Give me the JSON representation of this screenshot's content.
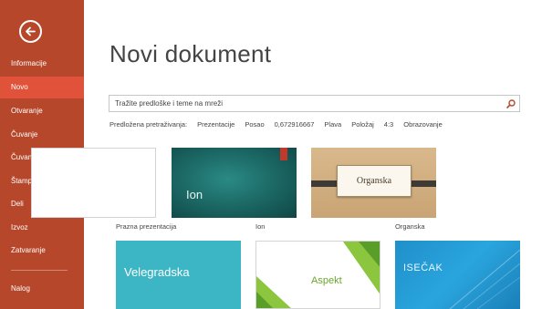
{
  "sidebar": {
    "back_label": "",
    "items": [
      {
        "label": "Informacije",
        "active": false
      },
      {
        "label": "Novo",
        "active": true
      },
      {
        "label": "Otvaranje",
        "active": false
      },
      {
        "label": "Čuvanje",
        "active": false
      },
      {
        "label": "Čuvanje kao",
        "active": false
      },
      {
        "label": "Štampanje",
        "active": false
      },
      {
        "label": "Deli",
        "active": false
      },
      {
        "label": "Izvoz",
        "active": false
      },
      {
        "label": "Zatvaranje",
        "active": false
      }
    ],
    "account": {
      "label": "Nalog"
    }
  },
  "main": {
    "title": "Novi dokument",
    "search": {
      "value": "",
      "placeholder": "Tražite predloške i teme na mreži"
    },
    "suggested": {
      "label": "Predložena pretraživanja:",
      "links": [
        "Prezentacije",
        "Posao",
        "0,672916667",
        "Plava",
        "Položaj",
        "4:3",
        "Obrazovanje"
      ]
    },
    "templates": [
      {
        "caption": "Prazna prezentacija",
        "preview_text": ""
      },
      {
        "caption": "Ion",
        "preview_text": "Ion"
      },
      {
        "caption": "Organska",
        "preview_text": "Organska"
      },
      {
        "caption": "",
        "preview_text": "Velegradska"
      },
      {
        "caption": "",
        "preview_text": "Aspekt"
      },
      {
        "caption": "",
        "preview_text": "ISEČAK"
      }
    ]
  },
  "colors": {
    "sidebar": "#b7472a",
    "sidebar_active": "#e0533a",
    "ion": "#1a6461",
    "velegradska": "#3cb5c5",
    "aspekt_green": "#6aa62b",
    "isecak": "#2aa5de"
  },
  "icons": {
    "back": "back-arrow-icon",
    "search": "search-icon"
  }
}
